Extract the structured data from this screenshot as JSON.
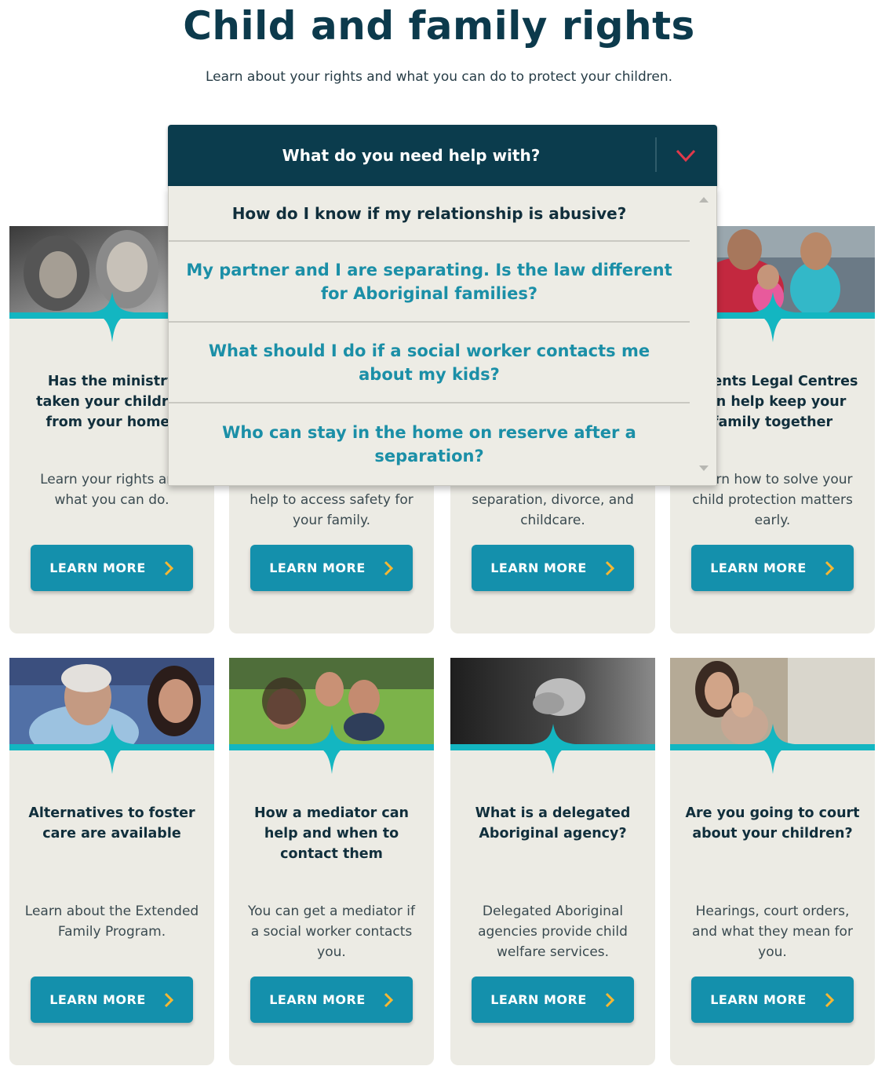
{
  "page": {
    "title": "Child and family rights",
    "subtitle": "Learn about your rights and what you can do to protect your children."
  },
  "dropdown": {
    "header": "What do you need help with?",
    "items": [
      "How do I know if my relationship is abusive?",
      "My partner and I are separating. Is the law different for Aboriginal families?",
      "What should I do if a social worker contacts me about my kids?",
      "Who can stay in the home on reserve after a separation?"
    ]
  },
  "cards": [
    {
      "title": "Has the ministry taken your children from your home?",
      "desc": "Learn your rights and what you can do.",
      "button": "LEARN MORE"
    },
    {
      "title": "",
      "desc": "help to access safety for your family.",
      "button": "LEARN MORE"
    },
    {
      "title": "",
      "desc": "separation, divorce, and childcare.",
      "button": "LEARN MORE"
    },
    {
      "title": "Parents Legal Centres can help keep your family together",
      "desc": "Learn how to solve your child protection matters early.",
      "button": "LEARN MORE"
    },
    {
      "title": "Alternatives to foster care are available",
      "desc": "Learn about the Extended Family Program.",
      "button": "LEARN MORE"
    },
    {
      "title": "How a mediator can help and when to contact them",
      "desc": "You can get a mediator if a social worker contacts you.",
      "button": "LEARN MORE"
    },
    {
      "title": "What is a delegated Aboriginal agency?",
      "desc": "Delegated Aboriginal agencies provide child welfare services.",
      "button": "LEARN MORE"
    },
    {
      "title": "Are you going to court about your children?",
      "desc": "Hearings, court orders, and what they mean for you.",
      "button": "LEARN MORE"
    }
  ],
  "colors": {
    "navy": "#0b3c4d",
    "teal": "#13b6c1",
    "button": "#1490ac",
    "card_bg": "#ecebe4",
    "link": "#1b8fa7",
    "chevron_red": "#e0394b"
  },
  "icons": {
    "dropdown": "chevron-down-icon",
    "button": "chevron-right-icon",
    "scroll_up": "triangle-up-icon",
    "scroll_down": "triangle-down-icon"
  }
}
